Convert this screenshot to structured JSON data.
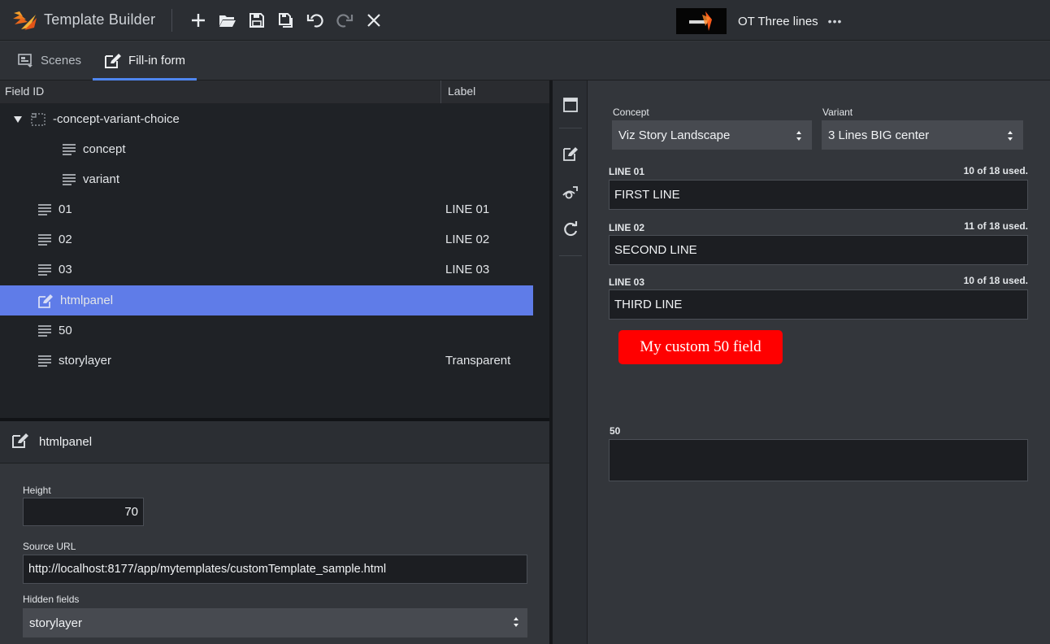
{
  "app": {
    "title": "Template Builder",
    "scene_name": "OT Three lines",
    "more_label": "•••"
  },
  "toolbar": {
    "icons": [
      "add-icon",
      "open-folder-icon",
      "save-icon",
      "save-as-icon",
      "undo-icon",
      "redo-icon",
      "close-icon"
    ]
  },
  "tabs": [
    {
      "label": "Scenes",
      "icon": "scenes-icon",
      "active": false
    },
    {
      "label": "Fill-in form",
      "icon": "edit-form-icon",
      "active": true
    }
  ],
  "tree": {
    "col_field_id": "Field ID",
    "col_label": "Label",
    "rows": [
      {
        "id": "-concept-variant-choice",
        "label": "",
        "icon": "group-icon",
        "expanded": true,
        "selected": false
      },
      {
        "id": "concept",
        "label": "",
        "icon": "text-field-icon",
        "selected": false
      },
      {
        "id": "variant",
        "label": "",
        "icon": "text-field-icon",
        "selected": false
      },
      {
        "id": "01",
        "label": "LINE 01",
        "icon": "text-field-icon",
        "selected": false
      },
      {
        "id": "02",
        "label": "LINE 02",
        "icon": "text-field-icon",
        "selected": false
      },
      {
        "id": "03",
        "label": "LINE 03",
        "icon": "text-field-icon",
        "selected": false
      },
      {
        "id": "htmlpanel",
        "label": "",
        "icon": "html-panel-icon",
        "selected": true
      },
      {
        "id": "50",
        "label": "",
        "icon": "text-field-icon",
        "selected": false
      },
      {
        "id": "storylayer",
        "label": "Transparent",
        "icon": "text-field-icon",
        "selected": false
      }
    ]
  },
  "props": {
    "title": "htmlpanel",
    "height_label": "Height",
    "height_value": "70",
    "source_url_label": "Source URL",
    "source_url_value": "http://localhost:8177/app/mytemplates/customTemplate_sample.html",
    "hidden_fields_label": "Hidden fields",
    "hidden_fields_value": "storylayer"
  },
  "form": {
    "concept_label": "Concept",
    "concept_value": "Viz Story Landscape",
    "variant_label": "Variant",
    "variant_value": "3 Lines BIG center",
    "lines": [
      {
        "label": "LINE 01",
        "count": "10 of 18 used.",
        "value": "FIRST LINE"
      },
      {
        "label": "LINE 02",
        "count": "11 of 18 used.",
        "value": "SECOND LINE"
      },
      {
        "label": "LINE 03",
        "count": "10 of 18 used.",
        "value": "THIRD LINE"
      }
    ],
    "custom_badge": "My custom 50 field",
    "field50_label": "50",
    "field50_value": ""
  },
  "colors": {
    "accent": "#4f86ef",
    "selection": "#5f7ce8",
    "badge_red": "#ff0000"
  }
}
